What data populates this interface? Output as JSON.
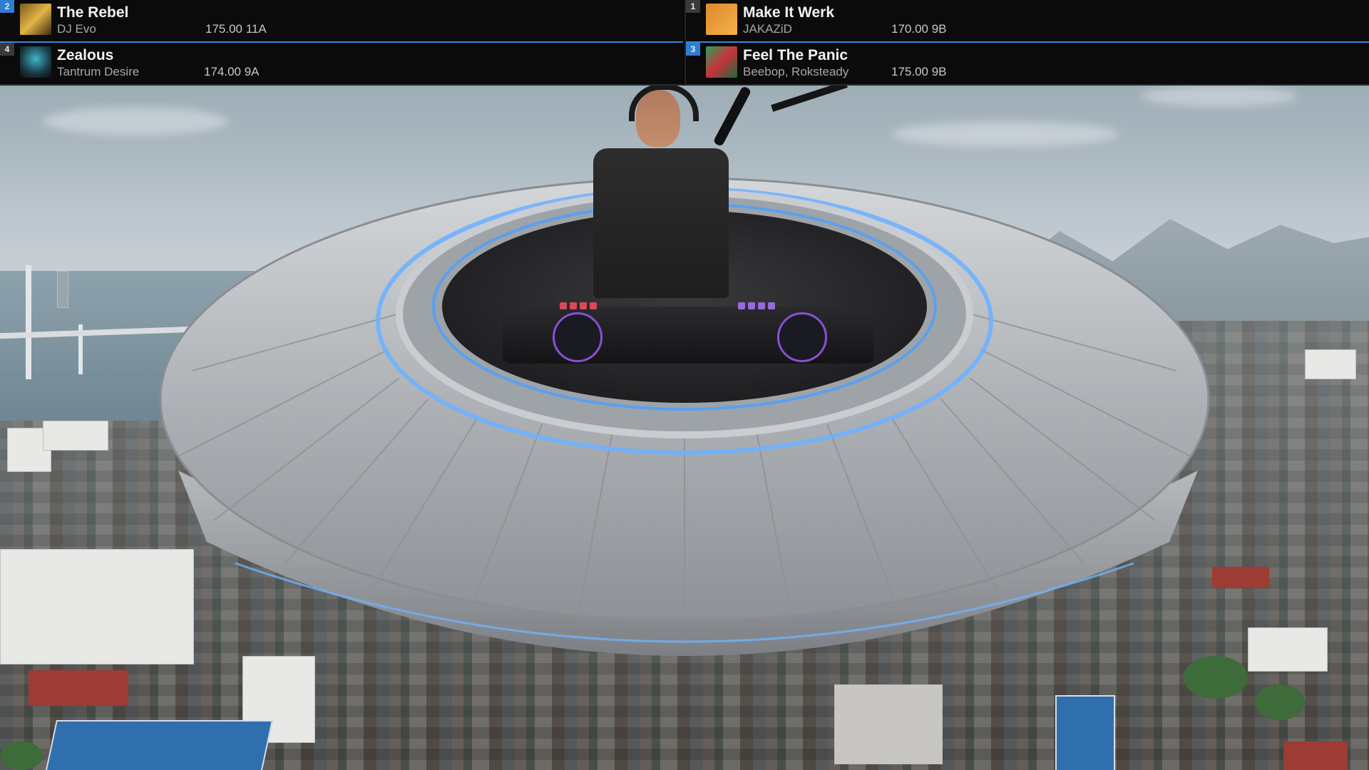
{
  "overlay": {
    "decks": [
      {
        "deck_number": "2",
        "title": "The Rebel",
        "artist": "DJ Evo",
        "bpm": "175.00",
        "key": "11A",
        "meta": "175.00 11A",
        "art": "album-art-gold",
        "accent": "#2e7ed4"
      },
      {
        "deck_number": "1",
        "title": "Make It Werk",
        "artist": "JAKAZiD",
        "bpm": "170.00",
        "key": "9B",
        "meta": "170.00 9B",
        "art": "album-art-orange",
        "accent": "#3a3a3a"
      },
      {
        "deck_number": "4",
        "title": "Zealous",
        "artist": "Tantrum Desire",
        "bpm": "174.00",
        "key": "9A",
        "meta": "174.00 9A",
        "art": "album-art-teal",
        "accent": "#3a3a3a"
      },
      {
        "deck_number": "3",
        "title": "Feel The Panic",
        "artist": "Beebop, Roksteady",
        "bpm": "175.00",
        "key": "9B",
        "meta": "175.00 9B",
        "art": "album-art-green-red",
        "accent": "#2e7ed4"
      }
    ]
  },
  "scene": {
    "description_icons": [
      "dj-webcam",
      "flying-saucer-stage",
      "city-aerial-background"
    ],
    "colors": {
      "saucer_metal": "#b8bcc0",
      "saucer_glow": "#6fb1ff",
      "bar_bg": "#0b0b0b"
    }
  }
}
